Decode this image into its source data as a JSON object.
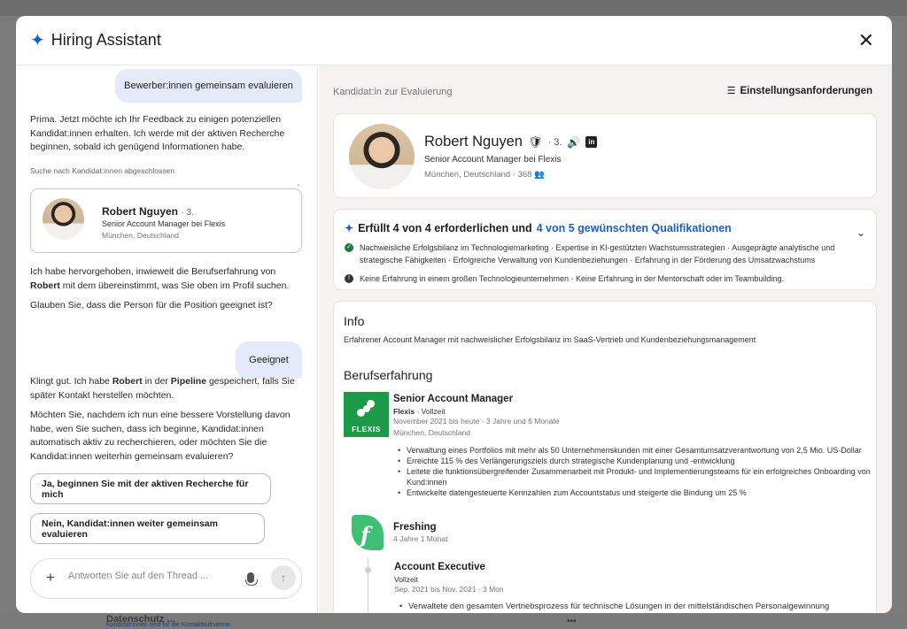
{
  "background": {
    "bottom_title": "Datenschutz ...",
    "bottom_note": "Kandidat:innen sind für die Kontaktaufnahme"
  },
  "header": {
    "title": "Hiring Assistant",
    "spark_icon": "sparkle-icon",
    "close_icon": "close-icon"
  },
  "chat": {
    "user_msg_1": "Bewerber:innen gemeinsam evaluieren",
    "assistant_msg_1": "Prima. Jetzt möchte ich Ihr Feedback zu einigen potenziellen Kandidat:innen erhalten. Ich werde mit der aktiven Recherche beginnen, sobald ich genügend Informationen habe.",
    "search_status": "Suche nach Kandidat:innen abgeschlossen",
    "candidate": {
      "name": "Robert Nguyen",
      "degree": "· 3.",
      "headline": "Senior Account Manager bei Flexis",
      "location": "München, Deutschland"
    },
    "assistant_msg_2_pre": "Ich habe hervorgehoben, inwieweit die Berufserfahrung von ",
    "assistant_msg_2_name": "Robert",
    "assistant_msg_2_post": " mit dem übereinstimmt, was Sie oben im Profil suchen.",
    "assistant_msg_3": "Glauben Sie, dass die Person für die Position geeignet ist?",
    "user_msg_2": "Geeignet",
    "assistant_msg_4_a": "Klingt gut. Ich habe ",
    "assistant_msg_4_name": "Robert",
    "assistant_msg_4_b": " in der ",
    "assistant_msg_4_pipeline": "Pipeline",
    "assistant_msg_4_c": " gespeichert, falls Sie später Kontakt herstellen möchten.",
    "assistant_msg_5": "Möchten Sie, nachdem ich nun eine bessere Vorstellung davon habe, wen Sie suchen, dass ich beginne, Kandidat:innen automatisch aktiv zu recherchieren, oder möchten Sie die Kandidat:innen weiterhin gemeinsam evaluieren?",
    "option_1": "Ja, beginnen Sie mit der aktiven Recherche für mich",
    "option_2": "Nein, Kandidat:innen weiter gemeinsam evaluieren",
    "input_placeholder": "Antworten Sie auf den Thread ...",
    "plus_icon": "plus-icon",
    "mic_icon": "microphone-icon",
    "send_icon": "send-arrow-icon"
  },
  "panel": {
    "label": "Kandidat:in zur Evaluierung",
    "requirements_link": "Einstellungsanforderungen",
    "profile": {
      "name": "Robert Nguyen",
      "degree": "· 3.",
      "headline": "Senior Account Manager bei Flexis",
      "location_connections": "München, Deutschland · 368"
    },
    "qualifications": {
      "title_a": "Erfüllt 4 von 4 erforderlichen und ",
      "title_b": "4 von 5 gewünschten Qualifikationen",
      "met": "Nachweisliche Erfolgsbilanz im Technologiemarketing · Expertise in KI-gestützten Wachstumsstrategien · Ausgeprägte analytische und strategische Fähigkeiten · Erfolgreiche Verwaltung von Kundenbeziehungen · Erfahrung in der Förderung des Umsatzwachstums",
      "missing": "Keine Erfahrung in einem großen Technologieunternehmen · Keine Erfahrung in der Mentorschaft oder im Teambuilding."
    },
    "info": {
      "heading": "Info",
      "text": "Erfahrener Account Manager mit nachweislicher Erfolgsbilanz im SaaS-Vertrieb und Kundenbeziehungsmanagement"
    },
    "experience": {
      "heading": "Berufserfahrung",
      "job1": {
        "logo_text": "FLEXIS",
        "title": "Senior Account Manager",
        "company": "Flexis",
        "type": " · Vollzeit",
        "dates": "November 2021 bis heute · 3 Jahre und 6 Monate",
        "location": "München, Deutschland",
        "bullets": [
          "Verwaltung eines Portfolios mit mehr als 50 Unternehmenskunden mit einer Gesamtumsatzverantwortung von 2,5 Mio. US-Dollar",
          "Erreichte 115 % des Verlängerungsziels durch strategische Kundenplanung und -entwicklung",
          "Leitete die funktionsübergreifender Zusammenarbeit mit Produkt- und Implementierungsteams für ein erfolgreiches Onboarding von Kund:innen",
          "Entwickelte datengesteuerte Kennzahlen zum Accountstatus und steigerte die Bindung um 25 %"
        ]
      },
      "job2": {
        "company": "Freshing",
        "duration": "4 Jahre 1 Monat",
        "role": "Account Executive",
        "type": "Vollzeit",
        "dates": "Sep. 2021 bis Nov. 2021 · 3 Mon",
        "bullet": "Verwaltete den gesamten Vertriebsprozess für technische Lösungen in der mittelständischen Personalgewinnung"
      }
    }
  }
}
